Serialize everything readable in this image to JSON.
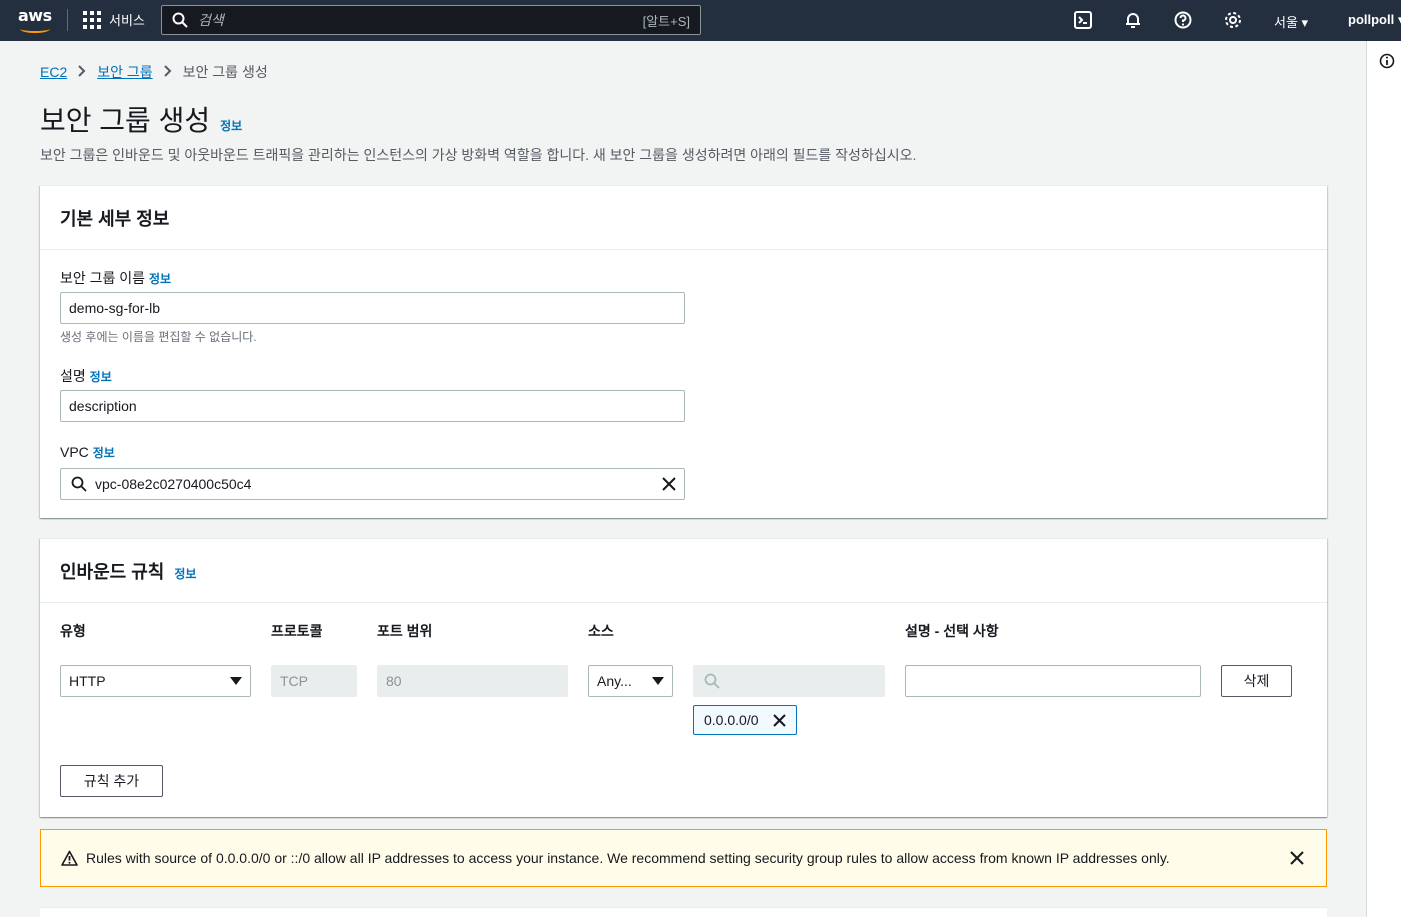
{
  "topnav": {
    "logo_text": "aws",
    "services_label": "서비스",
    "search_placeholder": "검색",
    "search_shortcut": "[알트+S]",
    "region_label": "서울 ▾",
    "user_label": "pollpoll ▾",
    "icons": [
      "cloudshell-icon",
      "bell-icon",
      "help-icon",
      "settings-icon"
    ]
  },
  "breadcrumb": {
    "items": [
      "EC2",
      "보안 그룹"
    ],
    "current": "보안 그룹 생성"
  },
  "page": {
    "title": "보안 그룹 생성",
    "info": "정보",
    "description": "보안 그룹은 인바운드 및 아웃바운드 트래픽을 관리하는 인스턴스의 가상 방화벽 역할을 합니다. 새 보안 그룹을 생성하려면 아래의 필드를 작성하십시오."
  },
  "basic": {
    "title": "기본 세부 정보",
    "name_label": "보안 그룹 이름",
    "name_value": "demo-sg-for-lb",
    "name_hint": "생성 후에는 이름을 편집할 수 없습니다.",
    "desc_label": "설명",
    "desc_value": "description",
    "vpc_label": "VPC",
    "vpc_value": "vpc-08e2c0270400c50c4",
    "info": "정보"
  },
  "inbound": {
    "title": "인바운드 규칙",
    "info": "정보",
    "columns": [
      "유형",
      "프로토콜",
      "포트 범위",
      "소스",
      "설명 - 선택 사항"
    ],
    "rule": {
      "type": "HTTP",
      "protocol": "TCP",
      "port": "80",
      "source": "Any...",
      "cidr": "0.0.0.0/0",
      "description": ""
    },
    "delete_label": "삭제",
    "add_label": "규칙 추가"
  },
  "warning": {
    "text": "Rules with source of 0.0.0.0/0 or ::/0 allow all IP addresses to access your instance. We recommend setting security group rules to allow access from known IP addresses only."
  }
}
